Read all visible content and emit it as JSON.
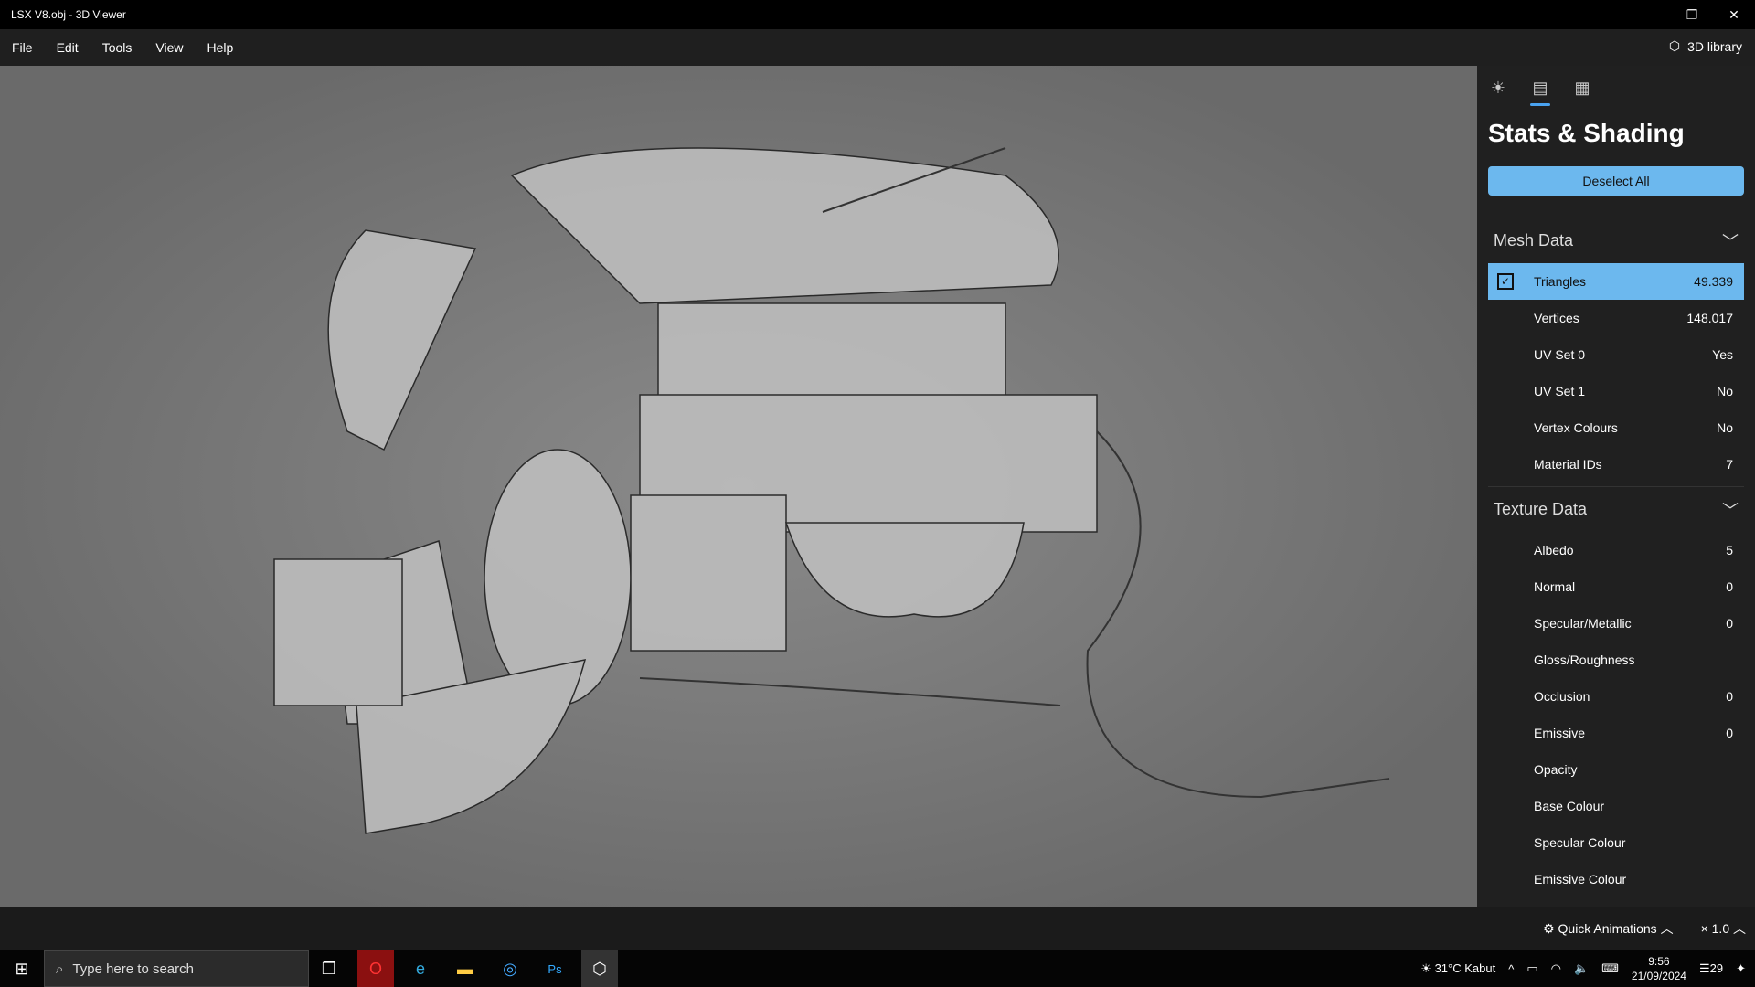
{
  "window": {
    "title": "LSX V8.obj - 3D Viewer",
    "minimize": "–",
    "restore": "❐",
    "close": "✕"
  },
  "menu": [
    "File",
    "Edit",
    "Tools",
    "View",
    "Help"
  ],
  "library_label": "3D library",
  "panel": {
    "title": "Stats & Shading",
    "deselect_label": "Deselect All",
    "mesh_section": "Mesh Data",
    "mesh_rows": [
      {
        "label": "Triangles",
        "value": "49.339"
      },
      {
        "label": "Vertices",
        "value": "148.017"
      },
      {
        "label": "UV Set 0",
        "value": "Yes"
      },
      {
        "label": "UV Set 1",
        "value": "No"
      },
      {
        "label": "Vertex Colours",
        "value": "No"
      },
      {
        "label": "Material IDs",
        "value": "7"
      }
    ],
    "texture_section": "Texture Data",
    "texture_rows": [
      {
        "label": "Albedo",
        "value": "5"
      },
      {
        "label": "Normal",
        "value": "0"
      },
      {
        "label": "Specular/Metallic",
        "value": "0"
      },
      {
        "label": "Gloss/Roughness",
        "value": ""
      },
      {
        "label": "Occlusion",
        "value": "0"
      },
      {
        "label": "Emissive",
        "value": "0"
      },
      {
        "label": "Opacity",
        "value": ""
      },
      {
        "label": "Base Colour",
        "value": ""
      },
      {
        "label": "Specular Colour",
        "value": ""
      },
      {
        "label": "Emissive Colour",
        "value": ""
      }
    ]
  },
  "bottom": {
    "quick_animations": "Quick Animations",
    "speed": "× 1.0"
  },
  "taskbar": {
    "search_placeholder": "Type here to search",
    "weather": "31°C  Kabut",
    "time": "9:56",
    "date": "21/09/2024",
    "notifications": "29"
  }
}
